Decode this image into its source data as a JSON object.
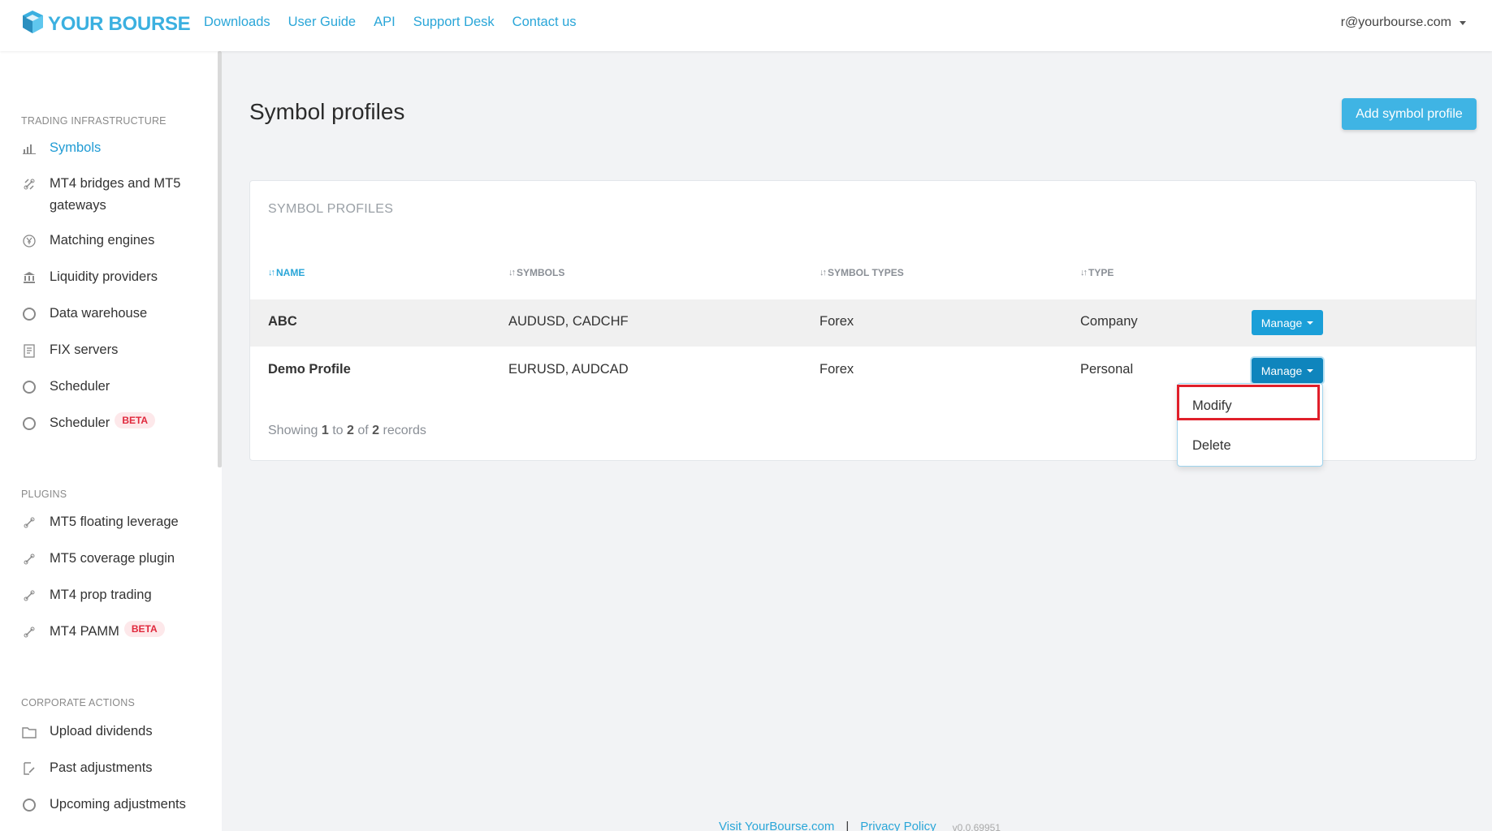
{
  "header": {
    "brand": "YOUR BOURSE",
    "nav": [
      "Downloads",
      "User Guide",
      "API",
      "Support Desk",
      "Contact us"
    ],
    "user_email": "r@yourbourse.com"
  },
  "sidebar": {
    "sections": [
      {
        "title": "TRADING INFRASTRUCTURE",
        "items": [
          {
            "label": "Symbols",
            "icon": "bar-chart-icon",
            "active": true
          },
          {
            "label": "MT4 bridges and MT5 gateways",
            "icon": "link-icon"
          },
          {
            "label": "Matching engines",
            "icon": "yen-icon"
          },
          {
            "label": "Liquidity providers",
            "icon": "bank-icon"
          },
          {
            "label": "Data warehouse",
            "icon": "circle-icon"
          },
          {
            "label": "FIX servers",
            "icon": "document-icon"
          },
          {
            "label": "Scheduler",
            "icon": "circle-icon"
          },
          {
            "label": "Scheduler",
            "icon": "circle-icon",
            "badge": "BETA"
          }
        ]
      },
      {
        "title": "PLUGINS",
        "items": [
          {
            "label": "MT5 floating leverage",
            "icon": "link-icon"
          },
          {
            "label": "MT5 coverage plugin",
            "icon": "link-icon"
          },
          {
            "label": "MT4 prop trading",
            "icon": "link-icon"
          },
          {
            "label": "MT4 PAMM",
            "icon": "link-icon",
            "badge": "BETA"
          }
        ]
      },
      {
        "title": "CORPORATE ACTIONS",
        "items": [
          {
            "label": "Upload dividends",
            "icon": "folder-icon"
          },
          {
            "label": "Past adjustments",
            "icon": "edit-doc-icon"
          },
          {
            "label": "Upcoming adjustments",
            "icon": "circle-icon"
          }
        ]
      }
    ]
  },
  "main": {
    "title": "Symbol profiles",
    "add_button": "Add symbol profile",
    "card_title": "SYMBOL PROFILES",
    "columns": [
      "NAME",
      "SYMBOLS",
      "SYMBOL TYPES",
      "TYPE"
    ],
    "rows": [
      {
        "name": "ABC",
        "symbols": "AUDUSD, CADCHF",
        "symbol_types": "Forex",
        "type": "Company",
        "action": "Manage"
      },
      {
        "name": "Demo Profile",
        "symbols": "EURUSD, AUDCAD",
        "symbol_types": "Forex",
        "type": "Personal",
        "action": "Manage"
      }
    ],
    "records": {
      "prefix": "Showing",
      "from": "1",
      "to_word": "to",
      "to": "2",
      "of_word": "of",
      "total": "2",
      "suffix": "records"
    },
    "dropdown": [
      "Modify",
      "Delete"
    ]
  },
  "footer": {
    "link1": "Visit YourBourse.com",
    "link2": "Privacy Policy",
    "version": "v0.0.69951"
  },
  "colors": {
    "accent": "#2aa6d8",
    "button": "#3fb4e4",
    "badge": "#e0283c",
    "highlight": "#e01f2a"
  }
}
